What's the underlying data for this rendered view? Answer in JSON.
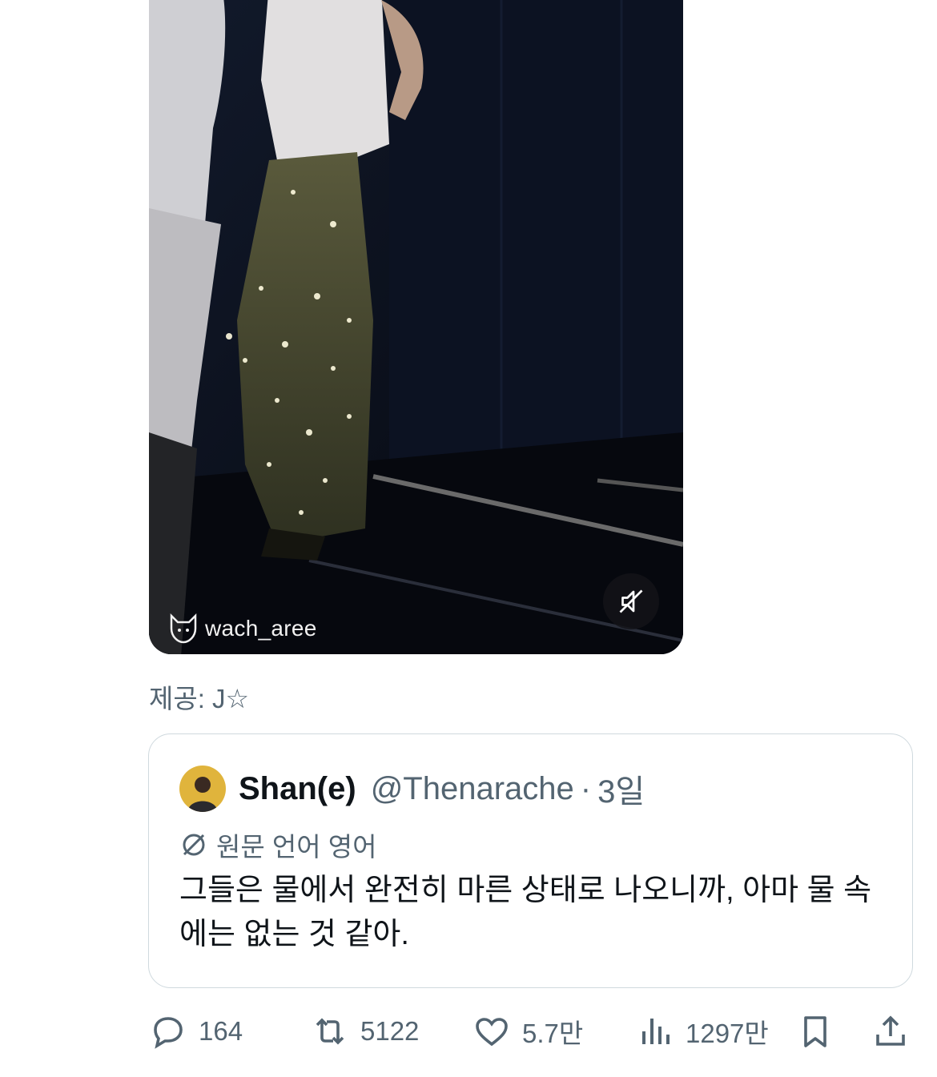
{
  "video": {
    "watermark": "wach_aree",
    "mute_icon": "speaker-muted-icon"
  },
  "credit": "제공: J☆",
  "quote": {
    "name": "Shan(e)",
    "handle": "@Thenarache",
    "separator": "·",
    "time": "3일",
    "language_note": "원문 언어 영어",
    "text": "그들은 물에서 완전히 마른 상태로 나오니까, 아마 물 속에는 없는 것 같아."
  },
  "actions": {
    "replies": "164",
    "reposts": "5122",
    "likes": "5.7만",
    "views": "1297만"
  },
  "colors": {
    "secondary_text": "#536471",
    "border": "#cfd9de",
    "primary_text": "#0f1419"
  }
}
